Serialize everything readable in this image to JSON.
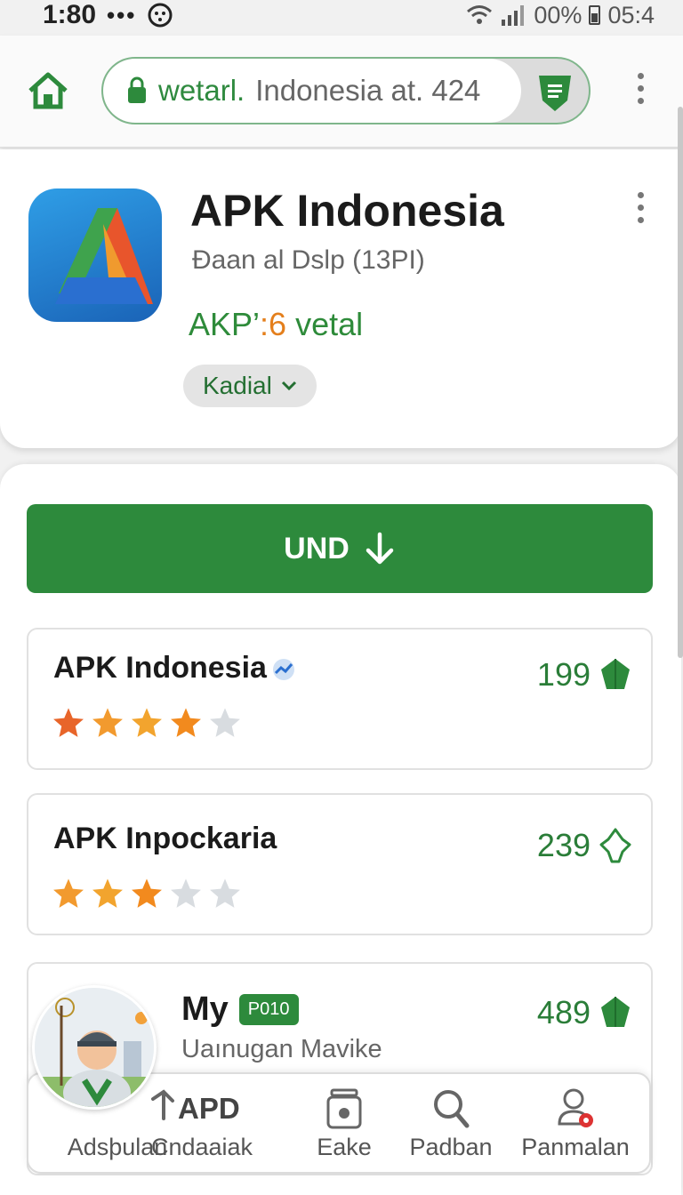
{
  "status_bar": {
    "time": "1:80",
    "dots": "•••",
    "battery_text": "00%",
    "clock_right": "05:4"
  },
  "browser": {
    "url_domain": "wetarl.",
    "url_rest": "Indonesia at. 424"
  },
  "app": {
    "title": "APK Indonesia",
    "subtitle": "Đaan al Dslp (13PI)",
    "meta_prefix": "AKP’",
    "meta_accent": ":6",
    "meta_suffix": " vetal",
    "chip_label": "Kadial"
  },
  "download": {
    "label": "UND"
  },
  "list": [
    {
      "name": "APK Indonesia",
      "rating": 4,
      "count": "199",
      "count_icon": "leaf-filled-icon"
    },
    {
      "name": "APK Inpockaria",
      "rating": 3,
      "count": "239",
      "count_icon": "leaf-outline-icon"
    },
    {
      "name": "My",
      "badge": "P010",
      "subtitle": "Uaınugan Mavike",
      "count": "489",
      "count_icon": "leaf-filled-icon"
    }
  ],
  "bottom_nav": {
    "apd": "APD",
    "items": [
      {
        "label": "Adsþulan",
        "icon": "person-icon"
      },
      {
        "label": "Cndaaiak",
        "icon": "shortcut-icon"
      },
      {
        "label": "Eake",
        "icon": "jar-icon"
      },
      {
        "label": "Padban",
        "icon": "search-icon"
      },
      {
        "label": "Panmalan",
        "icon": "profile-icon"
      }
    ]
  },
  "colors": {
    "primary_green": "#2d8a3c",
    "accent_orange": "#e47f1c",
    "star_gray": "#d8dce0"
  }
}
